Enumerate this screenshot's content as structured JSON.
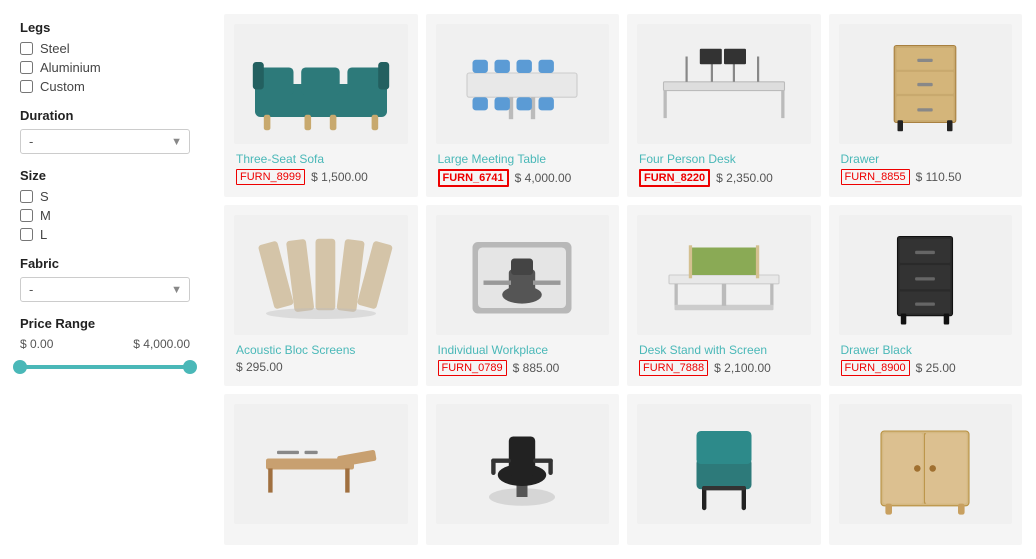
{
  "sidebar": {
    "sections": [
      {
        "id": "legs",
        "title": "Legs",
        "type": "checkboxes",
        "options": [
          {
            "label": "Steel",
            "checked": false
          },
          {
            "label": "Aluminium",
            "checked": false
          },
          {
            "label": "Custom",
            "checked": false
          }
        ]
      },
      {
        "id": "duration",
        "title": "Duration",
        "type": "select",
        "placeholder": "-",
        "options": [
          "-"
        ]
      },
      {
        "id": "size",
        "title": "Size",
        "type": "checkboxes",
        "options": [
          {
            "label": "S",
            "checked": false
          },
          {
            "label": "M",
            "checked": false
          },
          {
            "label": "L",
            "checked": false
          }
        ]
      },
      {
        "id": "fabric",
        "title": "Fabric",
        "type": "select",
        "placeholder": "-",
        "options": [
          "-"
        ]
      },
      {
        "id": "price-range",
        "title": "Price Range",
        "type": "range",
        "min_label": "$ 0.00",
        "max_label": "$ 4,000.00",
        "min": 0,
        "max": 4000,
        "current_min": 0,
        "current_max": 4000
      }
    ]
  },
  "products": [
    {
      "id": 1,
      "name": "Three-Seat Sofa",
      "sku": "FURN_8999",
      "price": "$ 1,500.00",
      "sku_highlighted": false,
      "shape": "sofa"
    },
    {
      "id": 2,
      "name": "Large Meeting Table",
      "sku": "FURN_6741",
      "price": "$ 4,000.00",
      "sku_highlighted": true,
      "shape": "meeting-table"
    },
    {
      "id": 3,
      "name": "Four Person Desk",
      "sku": "FURN_8220",
      "price": "$ 2,350.00",
      "sku_highlighted": true,
      "shape": "four-person-desk"
    },
    {
      "id": 4,
      "name": "Drawer",
      "sku": "FURN_8855",
      "price": "$ 110.50",
      "sku_highlighted": false,
      "shape": "drawer"
    },
    {
      "id": 5,
      "name": "Acoustic Bloc Screens",
      "sku": "",
      "price": "$ 295.00",
      "sku_highlighted": false,
      "shape": "acoustic-screens"
    },
    {
      "id": 6,
      "name": "Individual Workplace",
      "sku": "FURN_0789",
      "price": "$ 885.00",
      "sku_highlighted": false,
      "shape": "individual-workplace"
    },
    {
      "id": 7,
      "name": "Desk Stand with Screen",
      "sku": "FURN_7888",
      "price": "$ 2,100.00",
      "sku_highlighted": false,
      "shape": "desk-stand"
    },
    {
      "id": 8,
      "name": "Drawer Black",
      "sku": "FURN_8900",
      "price": "$ 25.00",
      "sku_highlighted": false,
      "shape": "drawer-black"
    },
    {
      "id": 9,
      "name": "",
      "sku": "",
      "price": "",
      "sku_highlighted": false,
      "shape": "desk-office"
    },
    {
      "id": 10,
      "name": "",
      "sku": "",
      "price": "",
      "sku_highlighted": false,
      "shape": "office-chair"
    },
    {
      "id": 11,
      "name": "",
      "sku": "",
      "price": "",
      "sku_highlighted": false,
      "shape": "side-chair"
    },
    {
      "id": 12,
      "name": "",
      "sku": "",
      "price": "",
      "sku_highlighted": false,
      "shape": "cabinet"
    }
  ]
}
